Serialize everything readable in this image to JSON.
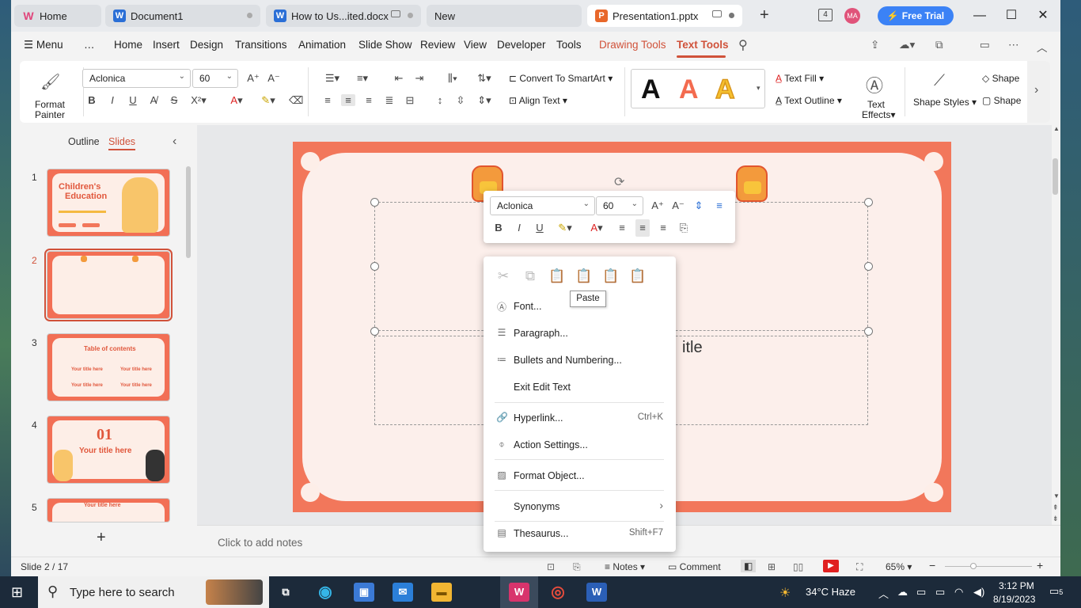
{
  "tabs": {
    "home": "Home",
    "doc1": "Document1",
    "doc2": "How to Us...ited.docx",
    "new": "New",
    "pres": "Presentation1.pptx"
  },
  "titlebar": {
    "tab_count": "4",
    "avatar": "MA",
    "free_trial": "Free Trial"
  },
  "menu": {
    "menu": "Menu",
    "more": "…",
    "items": [
      "Home",
      "Insert",
      "Design",
      "Transitions",
      "Animation",
      "Slide Show",
      "Review",
      "View",
      "Developer",
      "Tools",
      "Drawing Tools",
      "Text Tools"
    ]
  },
  "ribbon": {
    "format_painter_1": "Format",
    "format_painter_2": "Painter",
    "font": "Aclonica",
    "size": "60",
    "convert_smartart": "Convert To SmartArt",
    "align_text": "Align Text",
    "text_fill": "Text Fill",
    "text_outline": "Text Outline",
    "text_effects_1": "Text",
    "text_effects_2": "Effects",
    "shape_styles": "Shape Styles",
    "shape_fill": "Shape",
    "shape_outline": "Shape",
    "sample_letter": "A"
  },
  "panel": {
    "outline": "Outline",
    "slides": "Slides",
    "nums": [
      "1",
      "2",
      "3",
      "4",
      "5"
    ]
  },
  "thumb_text": {
    "t1a": "Children's",
    "t1b": "Education",
    "t3": "Table of contents",
    "t3items": [
      "Your title here",
      "Your title here",
      "Your title here",
      "Your title here"
    ],
    "t4num": "01",
    "t4title": "Your title here",
    "t5": "Your title here"
  },
  "slide": {
    "title_fragment": "itle"
  },
  "minibar": {
    "font": "Aclonica",
    "size": "60"
  },
  "context_menu": {
    "tooltip": "Paste",
    "font": "Font...",
    "paragraph": "Paragraph...",
    "bullets": "Bullets and Numbering...",
    "exit_edit": "Exit Edit Text",
    "hyperlink": "Hyperlink...",
    "hyperlink_sc": "Ctrl+K",
    "action": "Action Settings...",
    "format_obj": "Format Object...",
    "synonyms": "Synonyms",
    "thesaurus": "Thesaurus...",
    "thesaurus_sc": "Shift+F7"
  },
  "notes": {
    "placeholder": "Click to add notes"
  },
  "status": {
    "slide": "Slide 2 / 17",
    "notes": "Notes",
    "comment": "Comment",
    "zoom": "65%"
  },
  "taskbar": {
    "search": "Type here to search",
    "weather": "34°C  Haze",
    "time": "3:12 PM",
    "date": "8/19/2023",
    "notif": "5"
  },
  "colors": {
    "accent": "#d0523a",
    "slide_border": "#f2775b",
    "slide_bg": "#fcefeb",
    "free_trial": "#3b82f6"
  }
}
